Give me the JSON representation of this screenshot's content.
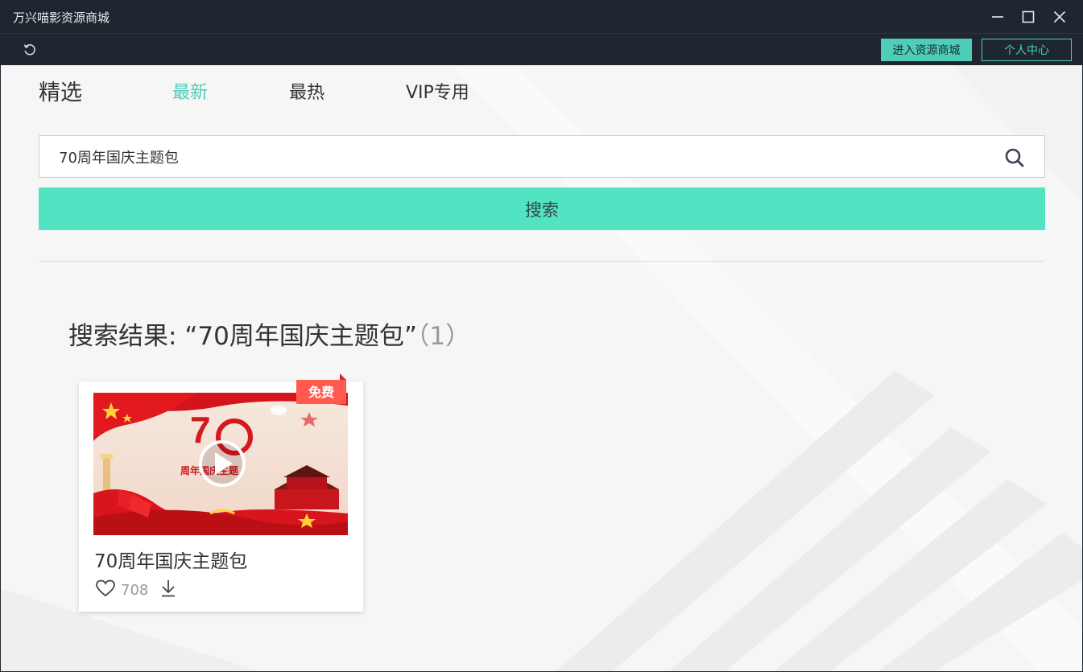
{
  "window": {
    "title": "万兴喵影资源商城"
  },
  "toolbar": {
    "store_label": "进入资源商城",
    "profile_label": "个人中心"
  },
  "tabs": [
    {
      "label": "精选"
    },
    {
      "label": "最新"
    },
    {
      "label": "最热"
    },
    {
      "label": "VIP专用"
    }
  ],
  "active_tab": "最新",
  "search": {
    "value": "70周年国庆主题包",
    "button_label": "搜索"
  },
  "results": {
    "prefix": "搜索结果: ",
    "query": "“70周年国庆主题包”",
    "count": "（1）"
  },
  "items": [
    {
      "title": "70周年国庆主题包",
      "badge": "免费",
      "likes": "708",
      "thumb_text": "周年国庆主题"
    }
  ],
  "colors": {
    "accent": "#4fcdb8",
    "search_button": "#52e3c3",
    "badge": "#ff5a4d",
    "titlebar": "#1e2630"
  },
  "icons": [
    "refresh-icon",
    "minimize-icon",
    "maximize-icon",
    "close-icon",
    "search-icon",
    "play-icon",
    "heart-icon",
    "download-icon"
  ]
}
